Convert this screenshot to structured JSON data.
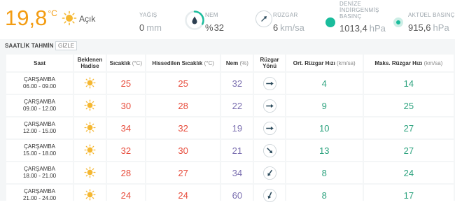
{
  "current": {
    "temperature": "19,8",
    "temp_unit": "°C",
    "condition": "Açık",
    "icon": "sun-icon",
    "rain": {
      "label": "YAĞIŞ",
      "value": "0",
      "unit": "mm"
    },
    "humidity": {
      "label": "NEM",
      "prefix": "%",
      "value": "32",
      "fraction": 0.32
    },
    "wind": {
      "label": "RÜZGAR",
      "value": "6",
      "unit": "km/sa"
    },
    "sea_pressure": {
      "label_lines": [
        "DENİZE",
        "İNDİRGENMİŞ",
        "BASINÇ"
      ],
      "value": "1013,4",
      "unit": "hPa"
    },
    "pressure": {
      "label": "AKTÜEL BASINÇ",
      "value": "915,6",
      "unit": "hPa"
    }
  },
  "forecast": {
    "title": "SAATLİK TAHMİN",
    "hide_label": "GİZLE",
    "headers": {
      "time": "Saat",
      "event_line1": "Beklenen",
      "event_line2": "Hadise",
      "temp": "Sıcaklık",
      "temp_unit": "(°C)",
      "feel": "Hissedilen Sıcaklık",
      "feel_unit": "(°C)",
      "hum": "Nem",
      "hum_unit": "(%)",
      "dir": "Rüzgar Yönü",
      "wind": "Ort. Rüzgar Hızı",
      "wind_unit": "(km/sa)",
      "gust": "Maks. Rüzgar Hızı",
      "gust_unit": "(km/sa)"
    },
    "rows": [
      {
        "day": "ÇARŞAMBA",
        "range": "06.00 - 09.00",
        "icon": "sun-icon",
        "temp": "25",
        "feel": "25",
        "hum": "32",
        "dir_deg": 90,
        "wind": "4",
        "gust": "14"
      },
      {
        "day": "ÇARŞAMBA",
        "range": "09.00 - 12.00",
        "icon": "sun-icon",
        "temp": "30",
        "feel": "28",
        "hum": "22",
        "dir_deg": 90,
        "wind": "9",
        "gust": "25"
      },
      {
        "day": "ÇARŞAMBA",
        "range": "12.00 - 15.00",
        "icon": "sun-icon",
        "temp": "34",
        "feel": "32",
        "hum": "19",
        "dir_deg": 90,
        "wind": "10",
        "gust": "27"
      },
      {
        "day": "ÇARŞAMBA",
        "range": "15.00 - 18.00",
        "icon": "sun-icon",
        "temp": "32",
        "feel": "30",
        "hum": "21",
        "dir_deg": 135,
        "wind": "13",
        "gust": "27"
      },
      {
        "day": "ÇARŞAMBA",
        "range": "18.00 - 21.00",
        "icon": "sun-icon",
        "temp": "28",
        "feel": "27",
        "hum": "34",
        "dir_deg": 215,
        "wind": "8",
        "gust": "24"
      },
      {
        "day": "ÇARŞAMBA",
        "range": "21.00 - 24.00",
        "icon": "sun-icon",
        "temp": "24",
        "feel": "24",
        "hum": "60",
        "dir_deg": 205,
        "wind": "8",
        "gust": "17"
      }
    ]
  },
  "colors": {
    "temp_current": "#f39c12",
    "temp": "#e74c3c",
    "humidity": "#7b6fb0",
    "wind": "#2ea37f",
    "accent_teal": "#1abc9c"
  }
}
